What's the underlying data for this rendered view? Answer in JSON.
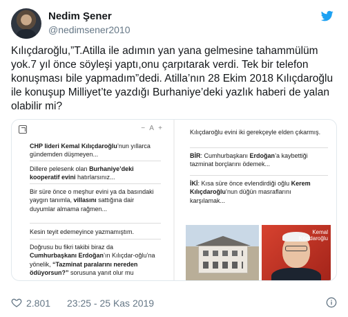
{
  "user": {
    "name": "Nedim Şener",
    "handle": "@nedimsener2010"
  },
  "tweet": {
    "text": "Kılıçdaroğlu,”T.Atilla ile adımın yan yana gelmesine tahammülüm yok.7 yıl önce söyleşi yaptı,onu çarpıtarak verdi. Tek bir telefon konuşması bile yapmadım”dedi. Atilla’nın 28 Ekim 2018 Kılıçdaroğlu ile konuşup Milliyet’te yazdığı Burhaniye’deki yazlık haberi de yalan olabilir mi?"
  },
  "media": {
    "left": {
      "font_controls": "− A +",
      "p1_a": "CHP lideri Kemal Kılıçdaroğlu",
      "p1_b": "’nun yıllarca gündemden düşmeyen...",
      "p2_a": "Dillere pelesenk olan ",
      "p2_b": "Burhaniye’deki kooperatif evini",
      "p2_c": " hatırlarsınız...",
      "p3_a": "Bir süre önce o meşhur evini ya da basındaki yaygın tanımla, ",
      "p3_b": "villasını",
      "p3_c": " sattığına dair duyumlar almama rağmen...",
      "p4": "Kesin teyit edemeyince yazmamıştım.",
      "p5_a": "Doğrusu bu fikri takibi biraz da ",
      "p5_b": "Cumhurbaşkanı Erdoğan",
      "p5_c": "’ın Kılıçdar-oğlu’na yönelik, ",
      "p5_d": "“Tazminat paralarını nereden ödüyorsun?”",
      "p5_e": " sorusuna yanıt olur mu"
    },
    "right": {
      "p1": "Kılıçdaroğlu evini iki gerekçeyle elden çıkarmış.",
      "p2_a": "BİR",
      "p2_b": ": Cumhurbaşkanı ",
      "p2_c": "Erdoğan",
      "p2_d": "’a kaybettiği tazminat borçlarını ödemek...",
      "p3_a": "İKİ",
      "p3_b": ": Kısa süre önce evlendirdiği oğlu ",
      "p3_c": "Kerem Kılıçdaroğlu",
      "p3_d": "’nun düğün masraflarını karşılamak...",
      "photo_label_1": "Kemal",
      "photo_label_2": "Kılıçdaroğlu"
    }
  },
  "footer": {
    "likes": "2.801",
    "timestamp": "23:25 - 25 Kas 2019"
  },
  "colors": {
    "twitter_blue": "#1da1f2",
    "text_primary": "#14171a",
    "text_secondary": "#657786"
  },
  "icons": {
    "brand": "twitter-bird-icon",
    "like": "heart-icon",
    "info": "info-icon",
    "share": "share-icon"
  }
}
